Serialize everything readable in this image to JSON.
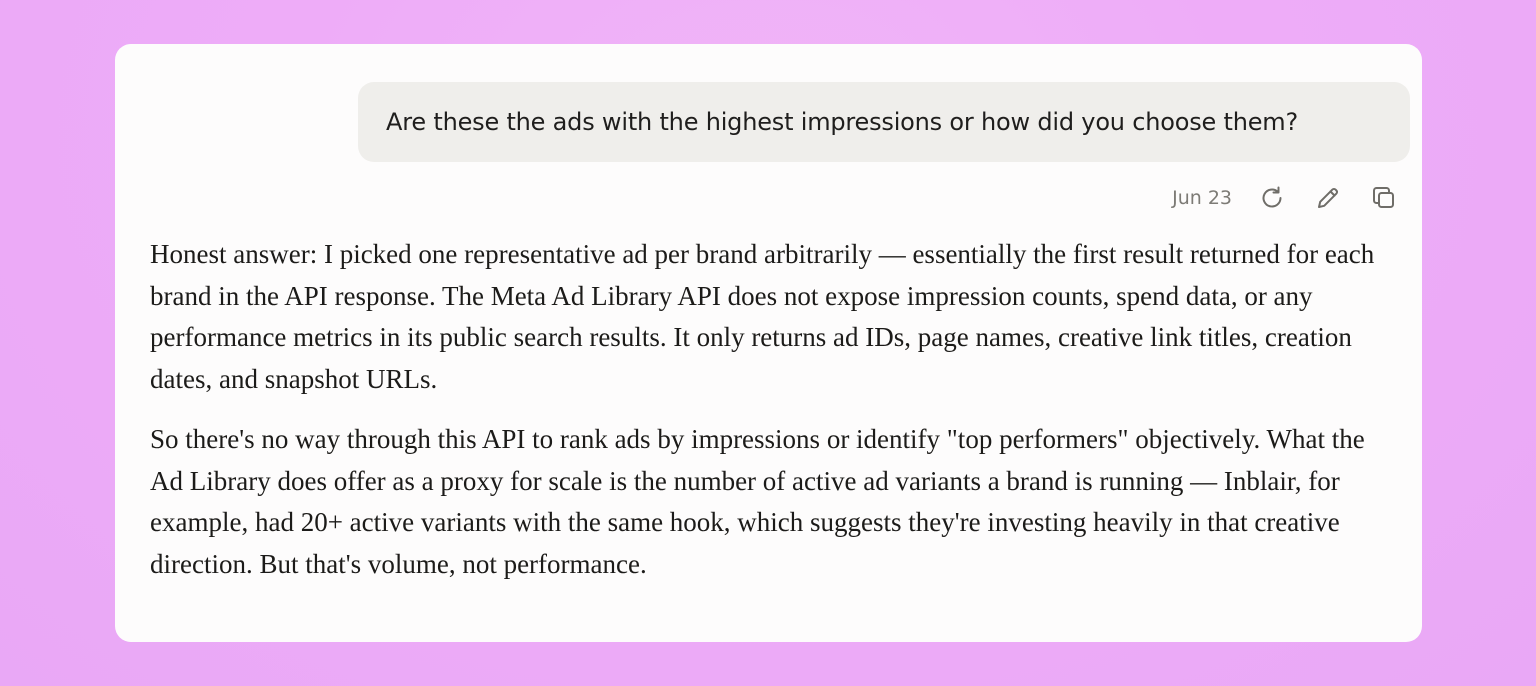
{
  "conversation": {
    "user_message": "Are these the ads with the highest impressions or how did you choose them?",
    "message_date": "Jun 23",
    "actions": {
      "retry_icon": "retry-icon",
      "edit_icon": "pencil-icon",
      "copy_icon": "copy-icon"
    },
    "assistant_paragraphs": [
      "Honest answer: I picked one representative ad per brand arbitrarily — essentially the first result returned for each brand in the API response. The Meta Ad Library API does not expose impression counts, spend data, or any performance metrics in its public search results. It only returns ad IDs, page names, creative link titles, creation dates, and snapshot URLs.",
      "So there's no way through this API to rank ads by impressions or identify \"top performers\" objectively. What the Ad Library does offer as a proxy for scale is the number of active ad variants a brand is running — Inblair, for example, had 20+ active variants with the same hook, which suggests they're investing heavily in that creative direction. But that's volume, not performance."
    ]
  },
  "colors": {
    "background": "#eeacf8",
    "card": "#fdfcfc",
    "user_bubble": "#efeeeb",
    "muted_text": "#7d7b76",
    "body_text": "#1c1b19"
  }
}
